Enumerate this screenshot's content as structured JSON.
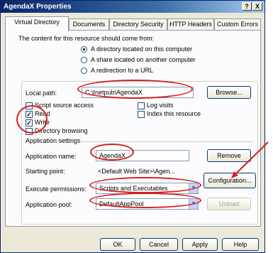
{
  "window": {
    "title": "AgendaX Properties",
    "help_label": "?",
    "close_label": "X"
  },
  "tabs": [
    {
      "label": "Virtual Directory"
    },
    {
      "label": "Documents"
    },
    {
      "label": "Directory Security"
    },
    {
      "label": "HTTP Headers"
    },
    {
      "label": "Custom Errors"
    }
  ],
  "content_source": {
    "prompt": "The content for this resource should come from:",
    "options": [
      {
        "label": "A directory located on this computer",
        "selected": true
      },
      {
        "label": "A share located on another computer",
        "selected": false
      },
      {
        "label": "A redirection to a URL",
        "selected": false
      }
    ]
  },
  "local_path": {
    "label": "Local path:",
    "value": "C:\\Inetpub\\AgendaX",
    "browse_label": "Browse..."
  },
  "permissions": {
    "script_source_access": {
      "label": "Script source access",
      "checked": false
    },
    "read": {
      "label": "Read",
      "checked": true
    },
    "write": {
      "label": "Write",
      "checked": true
    },
    "directory_browsing": {
      "label": "Directory browsing",
      "checked": false
    },
    "log_visits": {
      "label": "Log visits",
      "checked": false
    },
    "index_resource": {
      "label": "Index this resource",
      "checked": false
    }
  },
  "app_settings": {
    "header": "Application settings",
    "name_label": "Application name:",
    "name_value": "AgendaX",
    "remove_label": "Remove",
    "starting_point_label": "Starting point:",
    "starting_point_value": "<Default Web Site>\\Agen...",
    "configuration_label": "Configuration...",
    "exec_permissions_label": "Execute permissions:",
    "exec_permissions_value": "Scripts and Executables",
    "app_pool_label": "Application pool:",
    "app_pool_value": "DefaultAppPool",
    "unload_label": "Unload"
  },
  "footer": {
    "ok_label": "OK",
    "cancel_label": "Cancel",
    "apply_label": "Apply",
    "help_label": "Help"
  },
  "colors": {
    "annotation": "#d81e1e",
    "titlebar": "#0a246a"
  }
}
